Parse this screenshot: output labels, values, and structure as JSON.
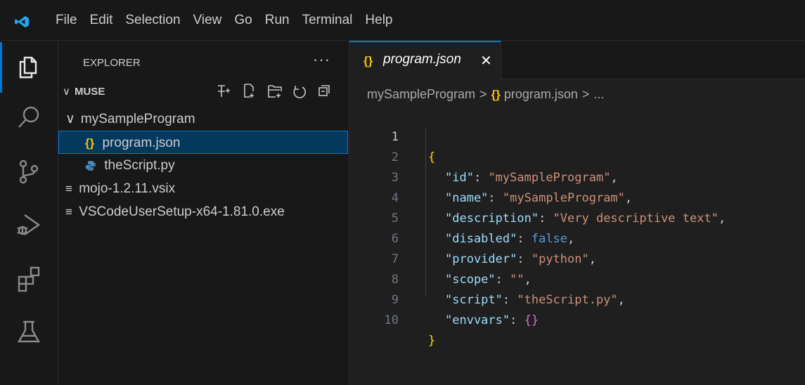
{
  "menu": [
    "File",
    "Edit",
    "Selection",
    "View",
    "Go",
    "Run",
    "Terminal",
    "Help"
  ],
  "activity": [
    "files-icon",
    "search-icon",
    "source-control-icon",
    "run-debug-icon",
    "extensions-icon",
    "testing-icon"
  ],
  "sidebar": {
    "title": "EXPLORER",
    "more": "···",
    "section": "MUSE",
    "tree": [
      {
        "label": "mySampleProgram",
        "type": "folder"
      },
      {
        "label": "program.json",
        "type": "json",
        "selected": true
      },
      {
        "label": "theScript.py",
        "type": "python"
      },
      {
        "label": "mojo-1.2.11.vsix",
        "type": "file"
      },
      {
        "label": "VSCodeUserSetup-x64-1.81.0.exe",
        "type": "file"
      }
    ]
  },
  "tab": {
    "label": "program.json",
    "close": "✕"
  },
  "breadcrumb": {
    "folder": "mySampleProgram",
    "file": "program.json",
    "more": "..."
  },
  "code": {
    "line_numbers": [
      "1",
      "2",
      "3",
      "4",
      "5",
      "6",
      "7",
      "8",
      "9",
      "10"
    ],
    "id_key": "\"id\"",
    "id_val": "\"mySampleProgram\"",
    "name_key": "\"name\"",
    "name_val": "\"mySampleProgram\"",
    "desc_key": "\"description\"",
    "desc_val": "\"Very descriptive text\"",
    "dis_key": "\"disabled\"",
    "dis_val": "false",
    "prov_key": "\"provider\"",
    "prov_val": "\"python\"",
    "scope_key": "\"scope\"",
    "scope_val": "\"\"",
    "script_key": "\"script\"",
    "script_val": "\"theScript.py\"",
    "env_key": "\"envvars\"",
    "env_val": "{}"
  }
}
